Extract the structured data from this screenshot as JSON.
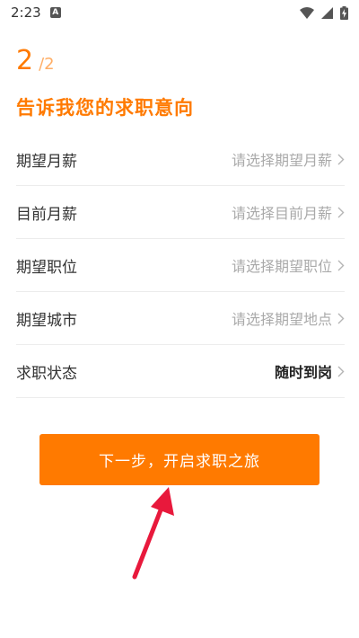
{
  "status_bar": {
    "time": "2:23",
    "notification_icon": "a-icon"
  },
  "step": {
    "current": "2",
    "total": "/2"
  },
  "page": {
    "title": "告诉我您的求职意向"
  },
  "form": {
    "rows": [
      {
        "label": "期望月薪",
        "value": "请选择期望月薪"
      },
      {
        "label": "目前月薪",
        "value": "请选择目前月薪"
      },
      {
        "label": "期望职位",
        "value": "请选择期望职位"
      },
      {
        "label": "期望城市",
        "value": "请选择期望地点"
      },
      {
        "label": "求职状态",
        "value": "随时到岗"
      }
    ]
  },
  "actions": {
    "next_label": "下一步，开启求职之旅"
  },
  "colors": {
    "accent": "#ff7a00",
    "annotation_arrow": "#e8193c"
  }
}
